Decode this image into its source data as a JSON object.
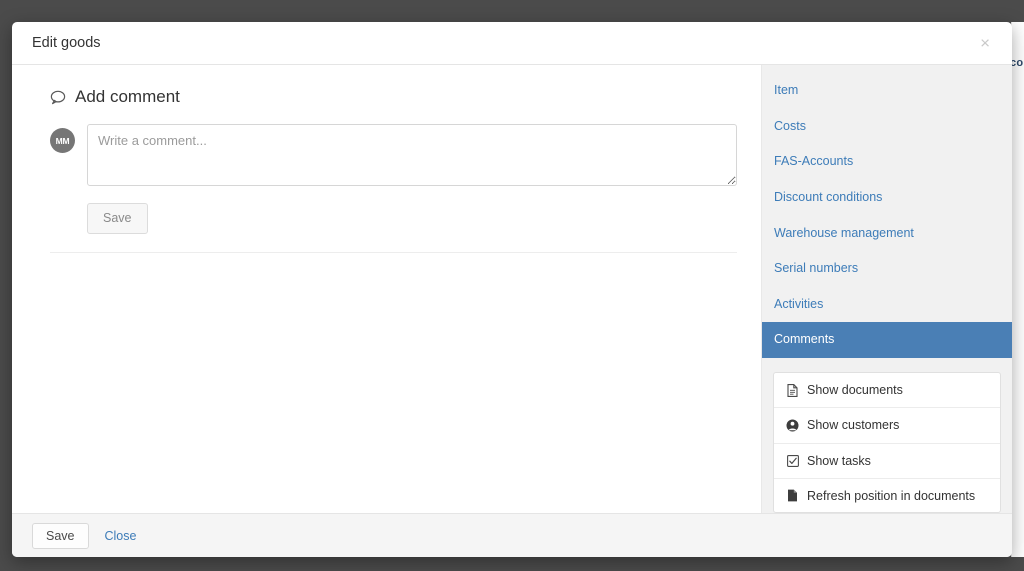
{
  "background": {
    "edge_text": "co"
  },
  "modal": {
    "title": "Edit goods",
    "close_icon": "close-icon",
    "close_label": "×"
  },
  "content": {
    "section_title": "Add comment",
    "section_icon": "speech-bubble-icon",
    "avatar_initials": "MM",
    "comment_placeholder": "Write a comment...",
    "comment_value": "",
    "save_label": "Save"
  },
  "sidebar": {
    "nav_items": [
      {
        "label": "Item",
        "active": false
      },
      {
        "label": "Costs",
        "active": false
      },
      {
        "label": "FAS-Accounts",
        "active": false
      },
      {
        "label": "Discount conditions",
        "active": false
      },
      {
        "label": "Warehouse management",
        "active": false
      },
      {
        "label": "Serial numbers",
        "active": false
      },
      {
        "label": "Activities",
        "active": false
      },
      {
        "label": "Comments",
        "active": true
      }
    ],
    "actions": [
      {
        "label": "Show documents",
        "icon": "document-outline-icon"
      },
      {
        "label": "Show customers",
        "icon": "user-circle-icon"
      },
      {
        "label": "Show tasks",
        "icon": "checkbox-checked-icon"
      },
      {
        "label": "Refresh position in documents",
        "icon": "file-filled-icon"
      }
    ]
  },
  "footer": {
    "save_label": "Save",
    "close_label": "Close"
  },
  "colors": {
    "overlay": "#4b4b4b",
    "link": "#3d7cb8",
    "active_nav": "#4a7fb5",
    "sidebar_bg": "#f1f1f1",
    "footer_bg": "#f5f5f5"
  }
}
